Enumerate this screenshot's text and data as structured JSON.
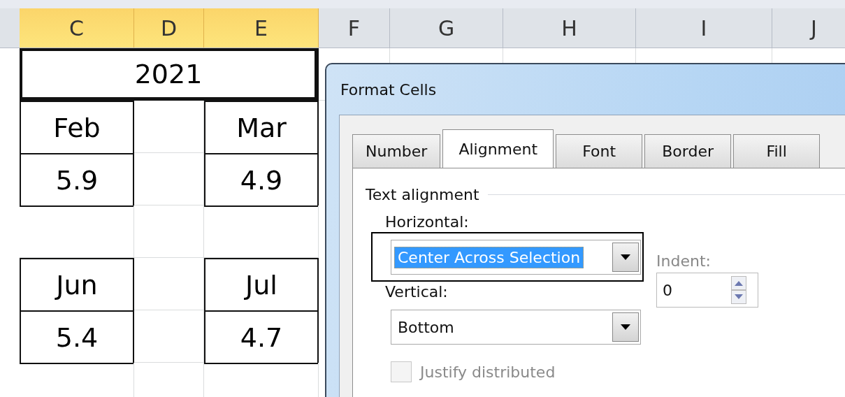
{
  "column_headers": [
    {
      "label": "C",
      "selected": true
    },
    {
      "label": "D",
      "selected": true
    },
    {
      "label": "E",
      "selected": true
    },
    {
      "label": "F",
      "selected": false
    },
    {
      "label": "G",
      "selected": false
    },
    {
      "label": "H",
      "selected": false
    },
    {
      "label": "I",
      "selected": false
    },
    {
      "label": "J",
      "selected": false
    }
  ],
  "title_cell": {
    "text": "2021",
    "selected": true
  },
  "month_blocks": [
    {
      "left": {
        "month": "Feb",
        "value": "5.9"
      },
      "right": {
        "month": "Mar",
        "value": "4.9"
      }
    },
    {
      "left": {
        "month": "Jun",
        "value": "5.4"
      },
      "right": {
        "month": "Jul",
        "value": "4.7"
      }
    }
  ],
  "dialog": {
    "title": "Format Cells",
    "tabs": [
      {
        "label": "Number",
        "selected": false
      },
      {
        "label": "Alignment",
        "selected": true
      },
      {
        "label": "Font",
        "selected": false
      },
      {
        "label": "Border",
        "selected": false
      },
      {
        "label": "Fill",
        "selected": false
      }
    ],
    "section": "Text alignment",
    "horizontal": {
      "label": "Horizontal:",
      "value": "Center Across Selection",
      "focused": true
    },
    "indent": {
      "label": "Indent:",
      "value": "0"
    },
    "vertical": {
      "label": "Vertical:",
      "value": "Bottom",
      "focused": false
    },
    "justify_distributed": {
      "label": "Justify distributed",
      "checked": false,
      "disabled": true
    }
  }
}
